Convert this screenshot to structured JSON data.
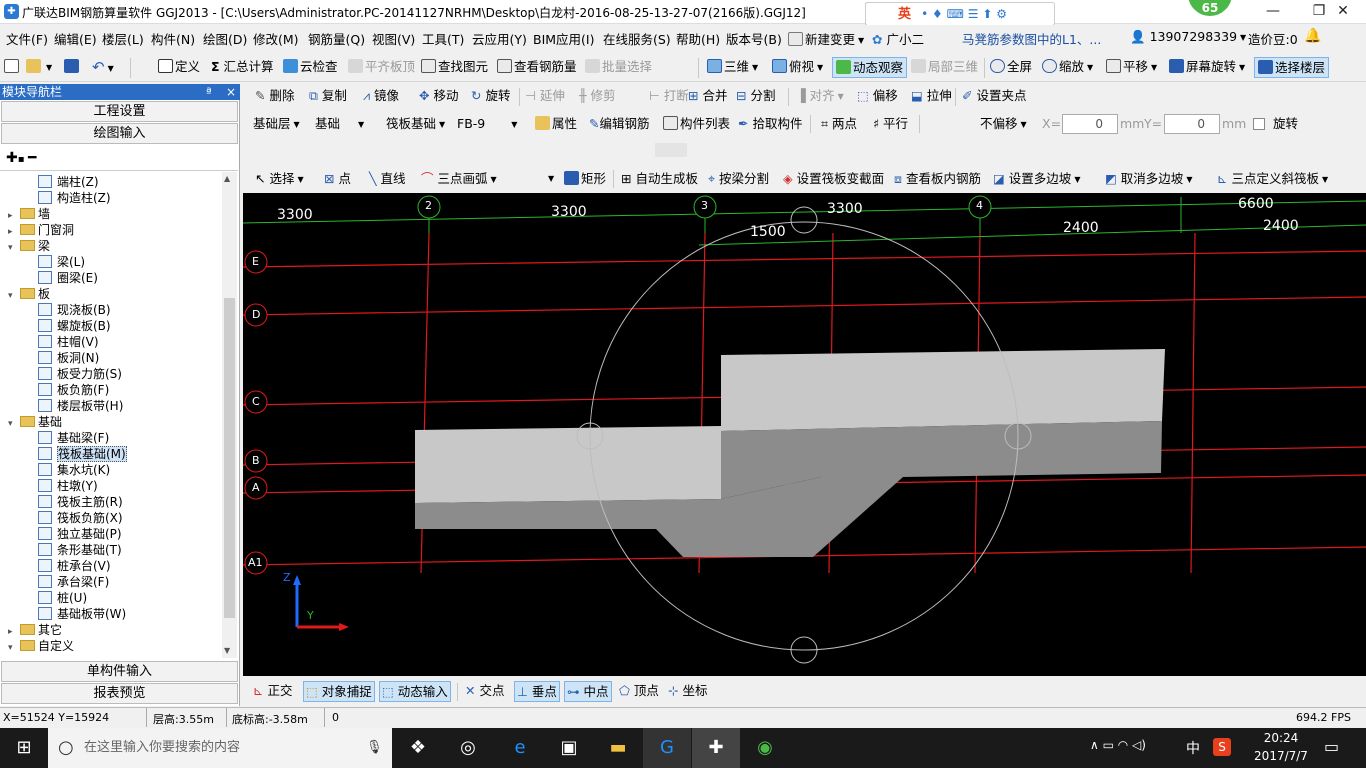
{
  "titlebar": {
    "title": "广联达BIM钢筋算量软件 GGJ2013 - [C:\\Users\\Administrator.PC-20141127NRHM\\Desktop\\白龙村-2016-08-25-13-27-07(2166版).GGJ12]",
    "app_icon": "app-logo-icon",
    "minimize": "—",
    "maximize": "❐",
    "close": "✕",
    "ime_logo": "S",
    "ime_lang": "英",
    "ime_icons": "• ♦ ⌨ ☰ ⬆ ⚙",
    "badge": "65"
  },
  "menubar": {
    "items": [
      "文件(F)",
      "编辑(E)",
      "楼层(L)",
      "构件(N)",
      "绘图(D)",
      "修改(M)",
      "钢筋量(Q)",
      "视图(V)",
      "工具(T)",
      "云应用(Y)",
      "BIM应用(I)",
      "在线服务(S)",
      "帮助(H)",
      "版本号(B)"
    ],
    "new_change": "新建变更",
    "guangxiaoer": "广小二",
    "marquee": "马凳筋参数图中的L1、...",
    "phone": "13907298339",
    "price_bean": "造价豆:0"
  },
  "toolbar1": {
    "define": "定义",
    "sum_calc": "汇总计算",
    "cloud_check": "云检查",
    "level_slab_top": "平齐板顶",
    "find_element": "查找图元",
    "view_rebar": "查看钢筋量",
    "batch_select": "批量选择",
    "view_3d": "三维",
    "top_view": "俯视",
    "dynamic_observe": "动态观察",
    "local_3d": "局部三维",
    "fullscreen": "全屏",
    "zoom": "缩放",
    "pan": "平移",
    "screen_rotate": "屏幕旋转",
    "select_floor": "选择楼层"
  },
  "toolbar2": {
    "delete": "删除",
    "copy": "复制",
    "mirror": "镜像",
    "move": "移动",
    "rotate": "旋转",
    "extend": "延伸",
    "trim": "修剪",
    "break": "打断",
    "merge": "合并",
    "split": "分割",
    "align": "对齐",
    "offset": "偏移",
    "stretch": "拉伸",
    "set_grip": "设置夹点"
  },
  "toolbar3": {
    "layer": "基础层",
    "category": "基础",
    "element_type": "筏板基础",
    "element_name": "FB-9",
    "properties": "属性",
    "edit_rebar": "编辑钢筋",
    "element_list": "构件列表",
    "pick_element": "拾取构件",
    "two_points": "两点",
    "parallel": "平行",
    "offset_mode": "不偏移",
    "x_label": "X=",
    "x_value": "0",
    "y_label": "Y=",
    "y_value": "0",
    "unit": "mm",
    "rotate_label": "旋转"
  },
  "toolbar4": {
    "select": "选择",
    "point": "点",
    "line": "直线",
    "arc3": "三点画弧",
    "rect": "矩形",
    "auto_slab": "自动生成板",
    "split_by_beam": "按梁分割",
    "set_raft_section": "设置筏板变截面",
    "view_slab_rebar": "查看板内钢筋",
    "set_multi_slope": "设置多边坡",
    "cancel_multi_slope": "取消多边坡",
    "three_point_slope": "三点定义斜筏板"
  },
  "left_panel": {
    "title": "模块导航栏",
    "pin": "ª",
    "close": "×",
    "project_settings": "工程设置",
    "drawing_input": "绘图输入",
    "single_element_input": "单构件输入",
    "report_preview": "报表预览",
    "tree": [
      {
        "label": "端柱(Z)",
        "type": "leaf",
        "level": 2
      },
      {
        "label": "构造柱(Z)",
        "type": "leaf",
        "level": 2
      },
      {
        "label": "墙",
        "type": "folder",
        "level": 1,
        "expanded": false
      },
      {
        "label": "门窗洞",
        "type": "folder",
        "level": 1,
        "expanded": false
      },
      {
        "label": "梁",
        "type": "folder",
        "level": 1,
        "expanded": true
      },
      {
        "label": "梁(L)",
        "type": "leaf",
        "level": 2
      },
      {
        "label": "圈梁(E)",
        "type": "leaf",
        "level": 2
      },
      {
        "label": "板",
        "type": "folder",
        "level": 1,
        "expanded": true
      },
      {
        "label": "现浇板(B)",
        "type": "leaf",
        "level": 2
      },
      {
        "label": "螺旋板(B)",
        "type": "leaf",
        "level": 2
      },
      {
        "label": "柱帽(V)",
        "type": "leaf",
        "level": 2
      },
      {
        "label": "板洞(N)",
        "type": "leaf",
        "level": 2
      },
      {
        "label": "板受力筋(S)",
        "type": "leaf",
        "level": 2
      },
      {
        "label": "板负筋(F)",
        "type": "leaf",
        "level": 2
      },
      {
        "label": "楼层板带(H)",
        "type": "leaf",
        "level": 2
      },
      {
        "label": "基础",
        "type": "folder",
        "level": 1,
        "expanded": true
      },
      {
        "label": "基础梁(F)",
        "type": "leaf",
        "level": 2
      },
      {
        "label": "筏板基础(M)",
        "type": "leaf",
        "level": 2,
        "selected": true
      },
      {
        "label": "集水坑(K)",
        "type": "leaf",
        "level": 2
      },
      {
        "label": "柱墩(Y)",
        "type": "leaf",
        "level": 2
      },
      {
        "label": "筏板主筋(R)",
        "type": "leaf",
        "level": 2
      },
      {
        "label": "筏板负筋(X)",
        "type": "leaf",
        "level": 2
      },
      {
        "label": "独立基础(P)",
        "type": "leaf",
        "level": 2
      },
      {
        "label": "条形基础(T)",
        "type": "leaf",
        "level": 2
      },
      {
        "label": "桩承台(V)",
        "type": "leaf",
        "level": 2
      },
      {
        "label": "承台梁(F)",
        "type": "leaf",
        "level": 2
      },
      {
        "label": "桩(U)",
        "type": "leaf",
        "level": 2
      },
      {
        "label": "基础板带(W)",
        "type": "leaf",
        "level": 2
      },
      {
        "label": "其它",
        "type": "folder",
        "level": 1,
        "expanded": false
      },
      {
        "label": "自定义",
        "type": "folder",
        "level": 1,
        "expanded": true
      }
    ]
  },
  "viewport": {
    "top_dims": [
      "3300",
      "3300",
      "3300",
      "6600"
    ],
    "sub_dims": [
      "1500",
      "2400",
      "2400"
    ],
    "col_axes": [
      "2",
      "3",
      "4"
    ],
    "row_axes": [
      "E",
      "D",
      "C",
      "B",
      "A",
      "A1"
    ],
    "axis_x": "X",
    "axis_y": "Y",
    "axis_z": "Z",
    "colors": {
      "grid_red": "#e0191b",
      "axis_green": "#2db52d",
      "bubble_grey": "#bdbdbd",
      "slab_top": "#c8c8c8",
      "slab_side": "#8c8c8c"
    }
  },
  "snapbar": {
    "ortho": "正交",
    "object_snap": "对象捕捉",
    "dynamic_input": "动态输入",
    "intersection": "交点",
    "perpendicular": "垂点",
    "midpoint": "中点",
    "vertex": "顶点",
    "coordinate": "坐标"
  },
  "statusbar": {
    "coords": "X=51524 Y=15924",
    "floor_height": "层高:3.55m",
    "bottom_elev": "底标高:-3.58m",
    "value": "0",
    "fps": "694.2 FPS"
  },
  "taskbar": {
    "search_placeholder": "在这里输入你要搜索的内容",
    "ime": "中",
    "time": "20:24",
    "date": "2017/7/7"
  }
}
